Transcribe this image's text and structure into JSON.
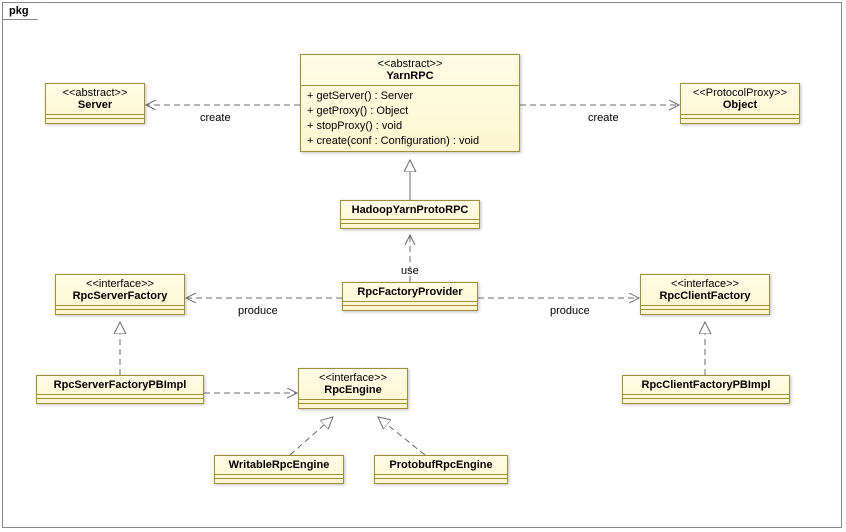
{
  "package": {
    "name": "pkg"
  },
  "classes": {
    "server": {
      "stereotype": "<<abstract>>",
      "name": "Server"
    },
    "yarnrpc": {
      "stereotype": "<<abstract>>",
      "name": "YarnRPC",
      "ops": [
        "+ getServer() : Server",
        "+ getProxy() : Object",
        "+ stopProxy() : void",
        "+ create(conf : Configuration) : void"
      ]
    },
    "object": {
      "stereotype": "<<ProtocolProxy>>",
      "name": "Object"
    },
    "hadoopyarnprotorpc": {
      "name": "HadoopYarnProtoRPC"
    },
    "rpcfactoryprovider": {
      "name": "RpcFactoryProvider"
    },
    "rpcserverfactory": {
      "stereotype": "<<interface>>",
      "name": "RpcServerFactory"
    },
    "rpcclientfactory": {
      "stereotype": "<<interface>>",
      "name": "RpcClientFactory"
    },
    "rpcserverfactorypbimpl": {
      "name": "RpcServerFactoryPBImpl"
    },
    "rpcclientfactorypbimpl": {
      "name": "RpcClientFactoryPBImpl"
    },
    "rpcengine": {
      "stereotype": "<<interface>>",
      "name": "RpcEngine"
    },
    "writablerpcengine": {
      "name": "WritableRpcEngine"
    },
    "protobufrpcengine": {
      "name": "ProtobufRpcEngine"
    }
  },
  "labels": {
    "create_left": "create",
    "create_right": "create",
    "use": "use",
    "produce_left": "produce",
    "produce_right": "produce"
  }
}
